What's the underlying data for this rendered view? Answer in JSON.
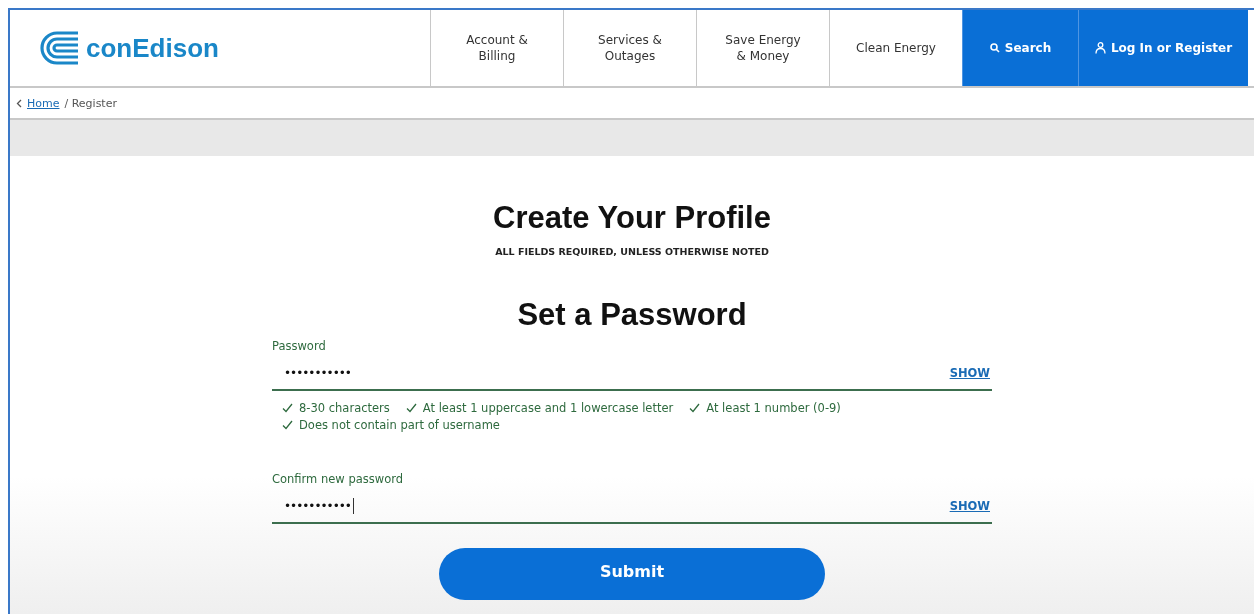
{
  "header": {
    "logo": "conEdison",
    "nav": [
      {
        "label": "Account & Billing",
        "kind": "plain"
      },
      {
        "label": "Services & Outages",
        "kind": "plain"
      },
      {
        "label": "Save Energy & Money",
        "kind": "plain"
      },
      {
        "label": "Clean Energy",
        "kind": "plain"
      },
      {
        "label": "Search",
        "kind": "search"
      },
      {
        "label": "Log In or Register",
        "kind": "login"
      }
    ]
  },
  "breadcrumb": {
    "link": "Home",
    "current": "/ Register"
  },
  "title": "Create Your Profile",
  "subtitle": "ALL FIELDS REQUIRED, UNLESS OTHERWISE NOTED",
  "section_title": "Set a Password",
  "password": {
    "label": "Password",
    "value": "•••••••••••",
    "toggle": "SHOW",
    "focused": false
  },
  "rules": [
    {
      "text": "8-30 characters",
      "met": true
    },
    {
      "text": "At least 1 uppercase and 1 lowercase letter",
      "met": true
    },
    {
      "text": "At least 1 number (0-9)",
      "met": true
    },
    {
      "text": "Does not contain part of username",
      "met": true
    }
  ],
  "confirm": {
    "label": "Confirm new password",
    "value": "•••••••••••",
    "toggle": "SHOW",
    "focused": true
  },
  "submit": "Submit"
}
